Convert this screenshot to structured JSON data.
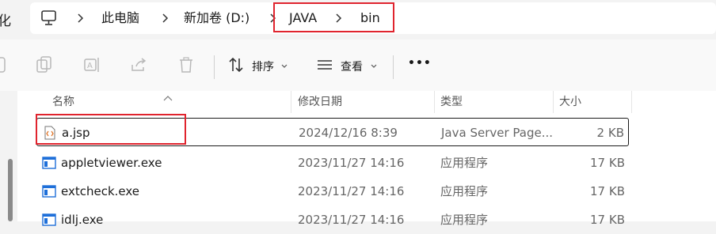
{
  "breadcrumb": {
    "left_fragment": "化",
    "items": [
      {
        "label": "此电脑"
      },
      {
        "label": "新加卷 (D:)"
      },
      {
        "label": "JAVA"
      },
      {
        "label": "bin"
      }
    ]
  },
  "toolbar": {
    "sort_label": "排序",
    "view_label": "查看",
    "more_label": "•••"
  },
  "columns": {
    "name": "名称",
    "date": "修改日期",
    "type": "类型",
    "size": "大小"
  },
  "files": [
    {
      "name": "a.jsp",
      "date": "2024/12/16 8:39",
      "type": "Java Server Page...",
      "size": "2 KB",
      "icon": "jsp-file-icon",
      "selected": true
    },
    {
      "name": "appletviewer.exe",
      "date": "2023/11/27 14:16",
      "type": "应用程序",
      "size": "17 KB",
      "icon": "exe-file-icon"
    },
    {
      "name": "extcheck.exe",
      "date": "2023/11/27 14:16",
      "type": "应用程序",
      "size": "17 KB",
      "icon": "exe-file-icon"
    },
    {
      "name": "idlj.exe",
      "date": "2023/11/27 14:16",
      "type": "应用程序",
      "size": "17 KB",
      "icon": "exe-file-icon"
    }
  ],
  "colors": {
    "highlight": "#e0242e",
    "exe_icon_blue": "#1e6fd9"
  }
}
